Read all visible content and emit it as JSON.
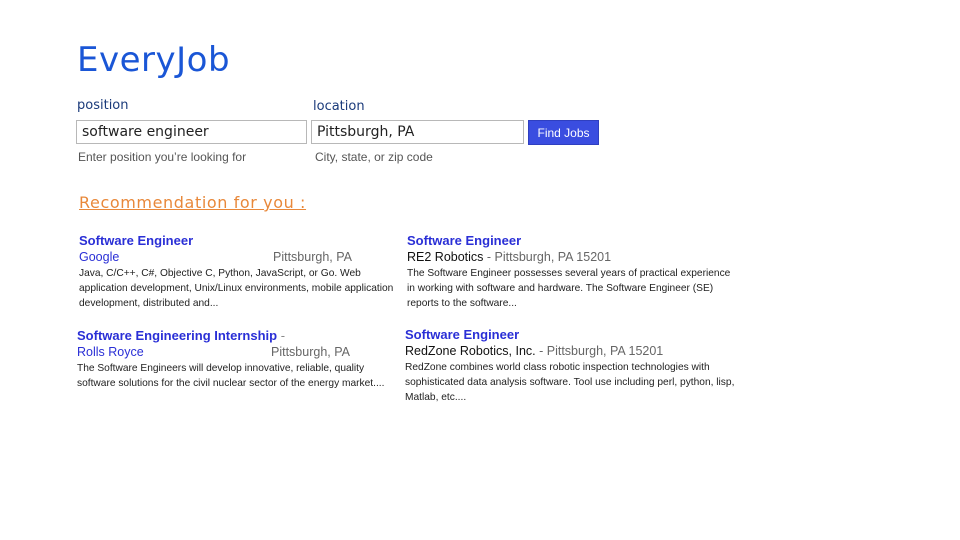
{
  "brand": "EveryJob",
  "search": {
    "position_label": "position",
    "position_value": "software engineer",
    "position_hint": "Enter position you’re looking for",
    "location_label": "location",
    "location_value": "Pittsburgh, PA",
    "location_hint": "City, state, or zip code",
    "button_label": "Find Jobs"
  },
  "recommendations": {
    "heading": "Recommendation for you :",
    "jobs": [
      {
        "title": "Software Engineer",
        "company": "Google",
        "location": "Pittsburgh, PA",
        "description": "Java, C/C++, C#, Objective C, Python, JavaScript, or Go. Web application development, Unix/Linux environments, mobile application development, distributed and..."
      },
      {
        "title": "Software Engineer",
        "company": "RE2 Robotics",
        "separator": " - ",
        "location": "Pittsburgh, PA 15201",
        "description": "The Software Engineer possesses several years of practical experience in working with software and hardware. The Software Engineer (SE) reports to the software..."
      },
      {
        "title": "Software Engineering Internship",
        "trail": " -",
        "company": "Rolls Royce",
        "location": "Pittsburgh, PA",
        "description": "The Software Engineers will develop innovative, reliable, quality software solutions for the civil nuclear sector of the energy market...."
      },
      {
        "title": "Software Engineer",
        "company": "RedZone Robotics, Inc.",
        "separator": " - ",
        "location": "Pittsburgh, PA 15201",
        "description": "RedZone combines world class robotic inspection technologies with sophisticated data analysis software. Tool use including perl, python, lisp, Matlab, etc...."
      }
    ]
  },
  "colors": {
    "brand": "#1a56d6",
    "link": "#2a2fd6",
    "accent": "#e8883a",
    "button": "#3a4de0"
  }
}
